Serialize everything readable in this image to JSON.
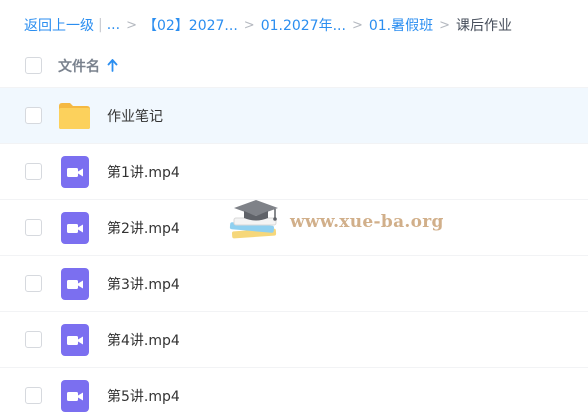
{
  "breadcrumb": {
    "back": "返回上一级",
    "ellipsis": "...",
    "items": [
      "【02】2027...",
      "01.2027年...",
      "01.暑假班"
    ],
    "current": "课后作业",
    "separator": ">"
  },
  "header": {
    "column_name": "文件名",
    "sort_direction": "ascending",
    "icons": {
      "sort": "arrow-up-icon"
    }
  },
  "files": [
    {
      "name": "作业笔记",
      "type": "folder",
      "icon": "folder-icon"
    },
    {
      "name": "第1讲.mp4",
      "type": "video",
      "icon": "video-file-icon"
    },
    {
      "name": "第2讲.mp4",
      "type": "video",
      "icon": "video-file-icon"
    },
    {
      "name": "第3讲.mp4",
      "type": "video",
      "icon": "video-file-icon"
    },
    {
      "name": "第4讲.mp4",
      "type": "video",
      "icon": "video-file-icon"
    },
    {
      "name": "第5讲.mp4",
      "type": "video",
      "icon": "video-file-icon"
    }
  ],
  "watermark": {
    "text": "www.xue-ba.org",
    "icon": "graduation-cap-books-icon"
  },
  "colors": {
    "link": "#2b8ef0",
    "folder": "#fcd15c",
    "video": "#7b6ff0",
    "selected_row": "#f1f8fe",
    "watermark": "#c9a276"
  }
}
